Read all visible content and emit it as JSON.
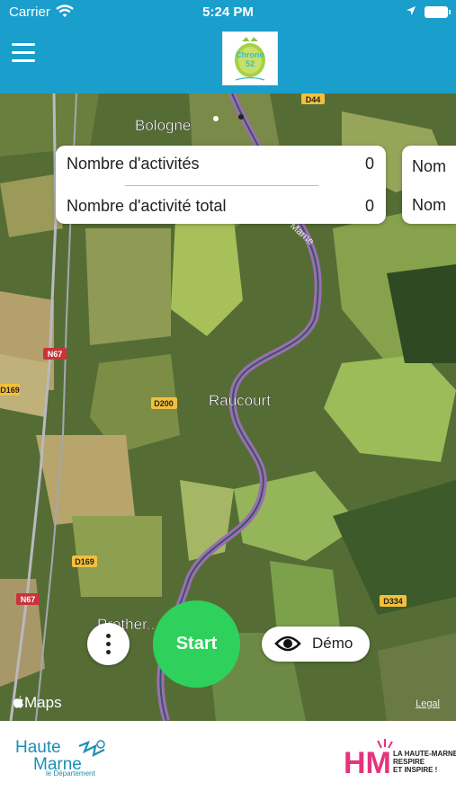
{
  "status": {
    "carrier": "Carrier",
    "time": "5:24 PM"
  },
  "header": {
    "logo_line1": "Chrono",
    "logo_line2": "52"
  },
  "map": {
    "places": [
      "Bologne",
      "Raucourt",
      "Prother..."
    ],
    "roads": [
      "D44",
      "N67",
      "D169",
      "D200",
      "D169",
      "N67",
      "D334"
    ],
    "river": "Marne",
    "attribution": "Maps",
    "legal": "Legal"
  },
  "stats": {
    "activities_label": "Nombre d'activités",
    "activities_value": "0",
    "total_label": "Nombre d'activité total",
    "total_value": "0",
    "peek_line1": "Nom",
    "peek_line2": "Nom"
  },
  "actions": {
    "start_label": "Start",
    "demo_label": "Démo"
  },
  "footer": {
    "left_logo": {
      "line1": "Haute",
      "line2": "Marne",
      "line3": "le Département"
    },
    "right_logo": {
      "mark": "HM",
      "line1": "LA HAUTE-MARNE",
      "line2": "RESPIRE",
      "line3": "ET INSPIRE !"
    }
  },
  "colors": {
    "header": "#1a9fcd",
    "start": "#2ed15c",
    "route": "#9a6fb0",
    "footer_pink": "#e5337f",
    "footer_teal": "#1b8fb4"
  }
}
